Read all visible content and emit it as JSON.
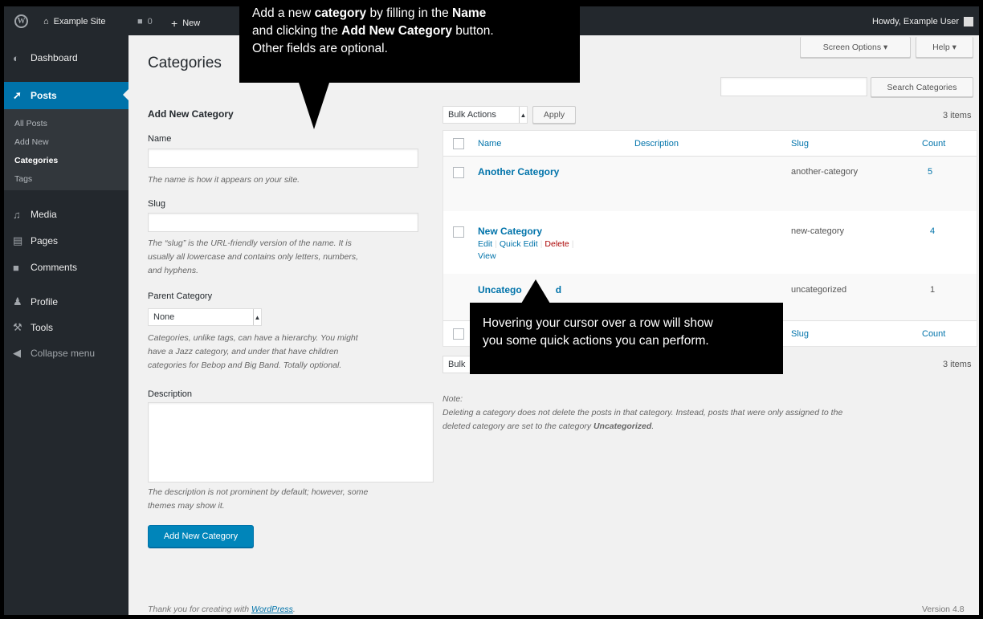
{
  "adminbar": {
    "site_name": "Example Site",
    "comments_count": "0",
    "new_label": "New",
    "greeting": "Howdy, Example User"
  },
  "sidebar": {
    "items": [
      {
        "label": "Dashboard",
        "icon": "dashboard-icon"
      },
      {
        "label": "Posts",
        "icon": "pin-icon"
      },
      {
        "label": "Media",
        "icon": "media-icon"
      },
      {
        "label": "Pages",
        "icon": "pages-icon"
      },
      {
        "label": "Comments",
        "icon": "comment-icon"
      },
      {
        "label": "Profile",
        "icon": "user-icon"
      },
      {
        "label": "Tools",
        "icon": "wrench-icon"
      },
      {
        "label": "Collapse menu",
        "icon": "collapse-icon"
      }
    ],
    "submenu": [
      "All Posts",
      "Add New",
      "Categories",
      "Tags"
    ]
  },
  "header": {
    "title": "Categories",
    "screen_options": "Screen Options",
    "help": "Help",
    "search_button": "Search Categories",
    "search_value": ""
  },
  "form": {
    "title": "Add New Category",
    "name_label": "Name",
    "name_value": "",
    "name_help": "The name is how it appears on your site.",
    "slug_label": "Slug",
    "slug_value": "",
    "slug_help_1": "The “slug” is the URL-friendly version of the name. It is",
    "slug_help_2": "usually all lowercase and contains only letters, numbers,",
    "slug_help_3": "and hyphens.",
    "parent_label": "Parent Category",
    "parent_value": "None",
    "parent_help_1": "Categories, unlike tags, can have a hierarchy. You might",
    "parent_help_2": "have a Jazz category, and under that have children",
    "parent_help_3": "categories for Bebop and Big Band. Totally optional.",
    "desc_label": "Description",
    "desc_value": "",
    "desc_help_1": "The description is not prominent by default; however, some",
    "desc_help_2": "themes may show it.",
    "submit": "Add New Category"
  },
  "list": {
    "bulk_actions": "Bulk Actions",
    "apply": "Apply",
    "items_count_top": "3 items",
    "items_count_bottom": "3 items",
    "bulk_actions_bottom": "Bulk",
    "columns": {
      "name": "Name",
      "description": "Description",
      "slug": "Slug",
      "count": "Count"
    },
    "rows": [
      {
        "name": "Another Category",
        "description": "",
        "slug": "another-category",
        "count": "5"
      },
      {
        "name": "New Category",
        "description": "",
        "slug": "new-category",
        "count": "4"
      },
      {
        "name": "Uncatego",
        "name_tail": "d",
        "description": "",
        "slug": "uncategorized",
        "count": "1"
      }
    ],
    "row_actions": {
      "edit": "Edit",
      "quick_edit": "Quick Edit",
      "delete": "Delete",
      "view": "View"
    },
    "footer_columns": {
      "slug": "Slug",
      "count": "Count"
    }
  },
  "note": {
    "title": "Note:",
    "line1": "Deleting a category does not delete the posts in that category. Instead, posts that were only assigned to the",
    "line2_a": "deleted category are set to the category ",
    "line2_b": "Uncategorized",
    "line2_c": "."
  },
  "footer": {
    "thanks_a": "Thank you for creating with ",
    "thanks_link": "WordPress",
    "thanks_b": ".",
    "version": "Version 4.8"
  },
  "callouts": {
    "top": {
      "l1_a": "Add a new ",
      "l1_b": "category",
      "l1_c": " by filling in the ",
      "l1_d": "Name",
      "l2_a": "and clicking the ",
      "l2_b": "Add New Category",
      "l2_c": " button.",
      "l3": "Other fields are optional."
    },
    "bottom": {
      "l1": "Hovering your cursor over a row will show",
      "l2": "you some quick actions you can perform."
    }
  }
}
